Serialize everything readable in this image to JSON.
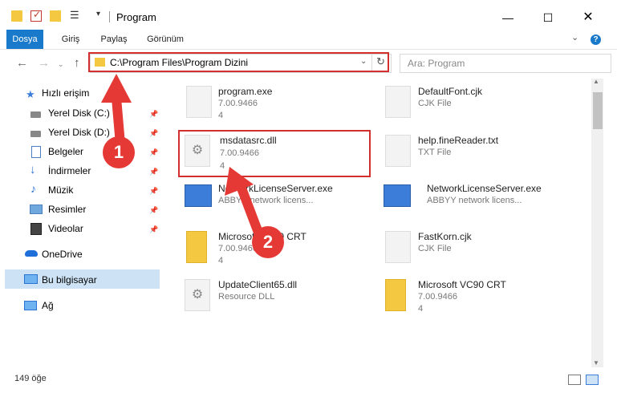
{
  "window": {
    "title": "Program",
    "minimize": "—",
    "maximize": "☐",
    "close": "✕"
  },
  "ribbon": {
    "tabs": [
      "Dosya",
      "Giriş",
      "Paylaş",
      "Görünüm"
    ],
    "expand": "⌄",
    "help": "?"
  },
  "nav": {
    "back": "←",
    "forward": "→",
    "recent": "⌄",
    "up": "↑",
    "address": "C:\\Program Files\\Program Dizini",
    "address_dropdown": "⌄",
    "refresh": "↻",
    "search_placeholder": "Ara: Program"
  },
  "sidebar": {
    "items": [
      {
        "label": "Hızlı erişim",
        "icon": "star-icon",
        "pinned": false
      },
      {
        "label": "Yerel Disk (C:)",
        "icon": "drive-icon",
        "pinned": true
      },
      {
        "label": "Yerel Disk (D:)",
        "icon": "drive-icon",
        "pinned": true
      },
      {
        "label": "Belgeler",
        "icon": "documents-icon",
        "pinned": true
      },
      {
        "label": "İndirmeler",
        "icon": "download-icon",
        "pinned": true
      },
      {
        "label": "Müzik",
        "icon": "music-icon",
        "pinned": true
      },
      {
        "label": "Resimler",
        "icon": "pictures-icon",
        "pinned": true
      },
      {
        "label": "Videolar",
        "icon": "video-icon",
        "pinned": true
      },
      {
        "label": "OneDrive",
        "icon": "cloud-icon",
        "pinned": false
      },
      {
        "label": "Bu bilgisayar",
        "icon": "computer-icon",
        "pinned": false
      },
      {
        "label": "Ağ",
        "icon": "network-icon",
        "pinned": false
      }
    ],
    "pin_glyph": "📌"
  },
  "files": {
    "left": [
      {
        "name": "program.exe",
        "line1": "7.00.9466",
        "line2": "4"
      },
      {
        "name": "msdatasrc.dll",
        "line1": "7.00.9466",
        "line2": "4"
      },
      {
        "name": "NetworkLicenseServer.exe",
        "line1": "ABBYY network licens...",
        "line2": ""
      },
      {
        "name": "Microsoft VC90 CRT",
        "line1": "7.00.9466",
        "line2": "4"
      },
      {
        "name": "UpdateClient65.dll",
        "line1": "Resource DLL",
        "line2": ""
      }
    ],
    "right": [
      {
        "name": "DefaultFont.cjk",
        "line1": "CJK File",
        "line2": ""
      },
      {
        "name": "help.fineReader.txt",
        "line1": "TXT File",
        "line2": ""
      },
      {
        "name": "NetworkLicenseServer.exe",
        "line1": "ABBYY network licens...",
        "line2": ""
      },
      {
        "name": "FastKorn.cjk",
        "line1": "CJK File",
        "line2": ""
      },
      {
        "name": "Microsoft VC90 CRT",
        "line1": "7.00.9466",
        "line2": "4"
      }
    ]
  },
  "status": {
    "item_count": "149 öğe"
  },
  "annotations": {
    "step1": "1",
    "step2": "2"
  },
  "colors": {
    "accent": "#1979ca",
    "highlight": "#d32f2f",
    "selection": "#cde3f5",
    "folder": "#f5c842"
  }
}
